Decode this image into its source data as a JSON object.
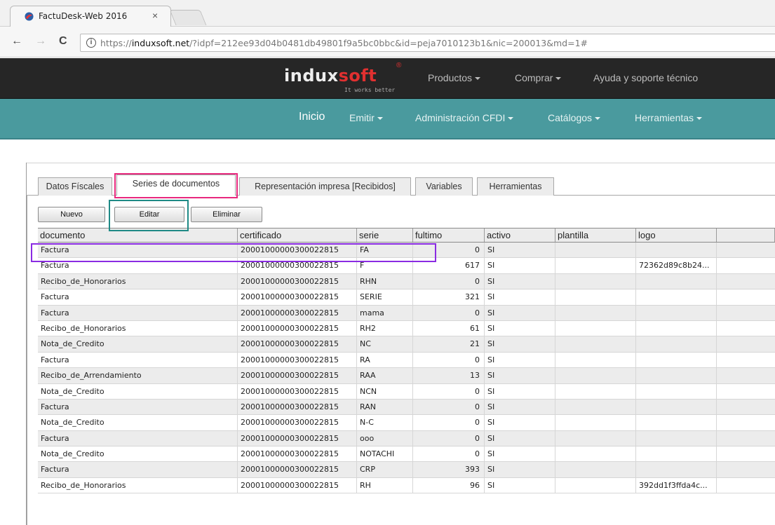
{
  "browser": {
    "tab_title": "FactuDesk-Web 2016",
    "tab_close": "×",
    "back": "←",
    "forward": "→",
    "reload": "C",
    "info": "i",
    "url_prefix": "https://",
    "url_host": "induxsoft.net",
    "url_path": "/?idpf=212ee93d04b0481db49801f9a5bc0bbc&id=peja7010123b1&nic=200013&md=1#"
  },
  "site": {
    "logo_part1": "indux",
    "logo_part2": "soft",
    "logo_reg": "®",
    "tagline": "It works better",
    "topnav": [
      "Productos",
      "Comprar",
      "Ayuda y soporte técnico"
    ],
    "subnav_home": "Inicio",
    "subnav": [
      "Emitir",
      "Administración CFDI",
      "Catálogos",
      "Herramientas"
    ]
  },
  "panel_tabs": [
    "Datos Físcales",
    "Series de documentos",
    "Representación impresa [Recibidos]",
    "Variables",
    "Herramientas"
  ],
  "active_tab": "Series de documentos",
  "buttons": {
    "nuevo": "Nuevo",
    "editar": "Editar",
    "eliminar": "Eliminar"
  },
  "grid": {
    "columns": [
      "documento",
      "certificado",
      "serie",
      "fultimo",
      "activo",
      "plantilla",
      "logo",
      ""
    ],
    "rows": [
      [
        "Factura",
        "20001000000300022815",
        "FA",
        "0",
        "SI",
        "",
        "",
        ""
      ],
      [
        "Factura",
        "20001000000300022815",
        "F",
        "617",
        "SI",
        "",
        "72362d89c8b24...",
        ""
      ],
      [
        "Recibo_de_Honorarios",
        "20001000000300022815",
        "RHN",
        "0",
        "SI",
        "",
        "",
        ""
      ],
      [
        "Factura",
        "20001000000300022815",
        "SERIE",
        "321",
        "SI",
        "",
        "",
        ""
      ],
      [
        "Factura",
        "20001000000300022815",
        "mama",
        "0",
        "SI",
        "",
        "",
        ""
      ],
      [
        "Recibo_de_Honorarios",
        "20001000000300022815",
        "RH2",
        "61",
        "SI",
        "",
        "",
        ""
      ],
      [
        "Nota_de_Credito",
        "20001000000300022815",
        "NC",
        "21",
        "SI",
        "",
        "",
        ""
      ],
      [
        "Factura",
        "20001000000300022815",
        "RA",
        "0",
        "SI",
        "",
        "",
        ""
      ],
      [
        "Recibo_de_Arrendamiento",
        "20001000000300022815",
        "RAA",
        "13",
        "SI",
        "",
        "",
        ""
      ],
      [
        "Nota_de_Credito",
        "20001000000300022815",
        "NCN",
        "0",
        "SI",
        "",
        "",
        ""
      ],
      [
        "Factura",
        "20001000000300022815",
        "RAN",
        "0",
        "SI",
        "",
        "",
        ""
      ],
      [
        "Nota_de_Credito",
        "20001000000300022815",
        "N-C",
        "0",
        "SI",
        "",
        "",
        ""
      ],
      [
        "Factura",
        "20001000000300022815",
        "ooo",
        "0",
        "SI",
        "",
        "",
        ""
      ],
      [
        "Nota_de_Credito",
        "20001000000300022815",
        "NOTACHI",
        "0",
        "SI",
        "",
        "",
        ""
      ],
      [
        "Factura",
        "20001000000300022815",
        "CRP",
        "393",
        "SI",
        "",
        "",
        ""
      ],
      [
        "Recibo_de_Honorarios",
        "20001000000300022815",
        "RH",
        "96",
        "SI",
        "",
        "392dd1f3ffda4c...",
        ""
      ]
    ]
  },
  "colors": {
    "header_bg": "#262626",
    "subnav_bg": "#4a9a9e",
    "highlight_tab": "#e8287e",
    "highlight_button": "#1f8a86",
    "highlight_row": "#8a2be2"
  }
}
